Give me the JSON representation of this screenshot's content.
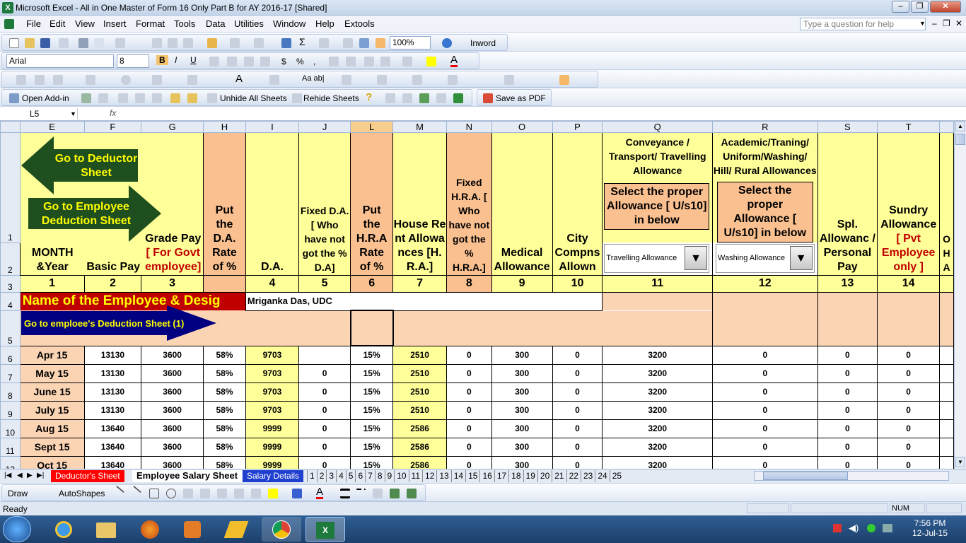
{
  "window": {
    "title": "Microsoft Excel - All in One Master of Form 16 Only Part  B for AY 2016-17  [Shared]"
  },
  "menu": [
    "File",
    "Edit",
    "View",
    "Insert",
    "Format",
    "Tools",
    "Data",
    "Utilities",
    "Window",
    "Help",
    "Extools"
  ],
  "help_placeholder": "Type a question for help",
  "toolbar": {
    "zoom": "100%",
    "inword": "Inword",
    "font": "Arial",
    "size": "8",
    "open_addin": "Open Add-in",
    "unhide": "Unhide All Sheets",
    "rehide": "Rehide Sheets",
    "save_pdf": "Save as PDF"
  },
  "namebox": "L5",
  "fx": "fx",
  "columns": [
    "E",
    "F",
    "G",
    "H",
    "I",
    "J",
    "L",
    "M",
    "N",
    "O",
    "P",
    "Q",
    "R",
    "S",
    "T"
  ],
  "rows": [
    "1",
    "2",
    "3",
    "4",
    "5",
    "6",
    "7",
    "8",
    "9",
    "10",
    "11",
    "12"
  ],
  "headers": {
    "e": "MONTH &Year",
    "f": "Basic Pay",
    "g1": "Grade Pay",
    "g2": "[ For Govt employee]",
    "h": "Put the D.A. Rate of %",
    "i": "D.A.",
    "j": "Fixed D.A. [ Who have not got the % D.A]",
    "l": "Put the H.R.A Rate of %",
    "m": "House Rent Allowances [H.R.A.]",
    "n": "Fixed H.R.A. [ Who have not got the % H.R.A.]",
    "o": "Medical Allowance",
    "p": "City Compns Allown",
    "q": "Conveyance / Transport/ Travelling Allowance",
    "q_box": "Select the proper Allowance [ U/s10] in below",
    "q_select": "Travelling Allowance",
    "r": "Academic/Traning/ Uniform/Washing/ Hill/ Rural Allowances",
    "r_box": "Select the proper Allowance [ U/s10] in below",
    "r_select": "Washing Allowance",
    "s": "Spl. Allowanc / Personal Pay",
    "t1": "Sundry Allowance",
    "t2": "[ Pvt Employee only ]",
    "u": "O H A"
  },
  "colnums": [
    "1",
    "2",
    "3",
    "",
    "4",
    "5",
    "6",
    "7",
    "8",
    "9",
    "10",
    "11",
    "12",
    "13",
    "14"
  ],
  "buttons": {
    "deductor": "Go to Deductor Sheet",
    "employee": "Go to Employee Deduction Sheet",
    "emp_ded": "Go to emploee's Deduction Sheet (1)"
  },
  "name_label": "Name of the Employee & Desig",
  "employee_name": "Mriganka Das, UDC",
  "data": [
    {
      "m": "Apr 15",
      "basic": "13130",
      "gp": "3600",
      "da_rate": "58%",
      "da": "9703",
      "fda": "",
      "hra_rate": "15%",
      "hra": "2510",
      "fhra": "0",
      "med": "300",
      "city": "0",
      "conv": "3200",
      "acad": "0",
      "spl": "0",
      "sundry": "0"
    },
    {
      "m": "May 15",
      "basic": "13130",
      "gp": "3600",
      "da_rate": "58%",
      "da": "9703",
      "fda": "0",
      "hra_rate": "15%",
      "hra": "2510",
      "fhra": "0",
      "med": "300",
      "city": "0",
      "conv": "3200",
      "acad": "0",
      "spl": "0",
      "sundry": "0"
    },
    {
      "m": "June 15",
      "basic": "13130",
      "gp": "3600",
      "da_rate": "58%",
      "da": "9703",
      "fda": "0",
      "hra_rate": "15%",
      "hra": "2510",
      "fhra": "0",
      "med": "300",
      "city": "0",
      "conv": "3200",
      "acad": "0",
      "spl": "0",
      "sundry": "0"
    },
    {
      "m": "July 15",
      "basic": "13130",
      "gp": "3600",
      "da_rate": "58%",
      "da": "9703",
      "fda": "0",
      "hra_rate": "15%",
      "hra": "2510",
      "fhra": "0",
      "med": "300",
      "city": "0",
      "conv": "3200",
      "acad": "0",
      "spl": "0",
      "sundry": "0"
    },
    {
      "m": "Aug 15",
      "basic": "13640",
      "gp": "3600",
      "da_rate": "58%",
      "da": "9999",
      "fda": "0",
      "hra_rate": "15%",
      "hra": "2586",
      "fhra": "0",
      "med": "300",
      "city": "0",
      "conv": "3200",
      "acad": "0",
      "spl": "0",
      "sundry": "0"
    },
    {
      "m": "Sept 15",
      "basic": "13640",
      "gp": "3600",
      "da_rate": "58%",
      "da": "9999",
      "fda": "0",
      "hra_rate": "15%",
      "hra": "2586",
      "fhra": "0",
      "med": "300",
      "city": "0",
      "conv": "3200",
      "acad": "0",
      "spl": "0",
      "sundry": "0"
    },
    {
      "m": "Oct 15",
      "basic": "13640",
      "gp": "3600",
      "da_rate": "58%",
      "da": "9999",
      "fda": "0",
      "hra_rate": "15%",
      "hra": "2586",
      "fhra": "0",
      "med": "300",
      "city": "0",
      "conv": "3200",
      "acad": "0",
      "spl": "0",
      "sundry": "0"
    }
  ],
  "tabs": [
    "Deductor's Sheet",
    "Employee Salary Sheet",
    "Salary Details",
    "1",
    "2",
    "3",
    "4",
    "5",
    "6",
    "7",
    "8",
    "9",
    "10",
    "11",
    "12",
    "13",
    "14",
    "15",
    "16",
    "17",
    "18",
    "19",
    "20",
    "21",
    "22",
    "23",
    "24",
    "25"
  ],
  "drawbar": {
    "draw": "Draw",
    "autoshapes": "AutoShapes"
  },
  "status": {
    "ready": "Ready",
    "num": "NUM"
  },
  "clock": {
    "time": "7:56 PM",
    "date": "12-Jul-15"
  },
  "colors": {
    "yellow": "#ffff99",
    "orange": "#fac090",
    "dark_green": "#1f4e1f",
    "navy": "#000080"
  }
}
